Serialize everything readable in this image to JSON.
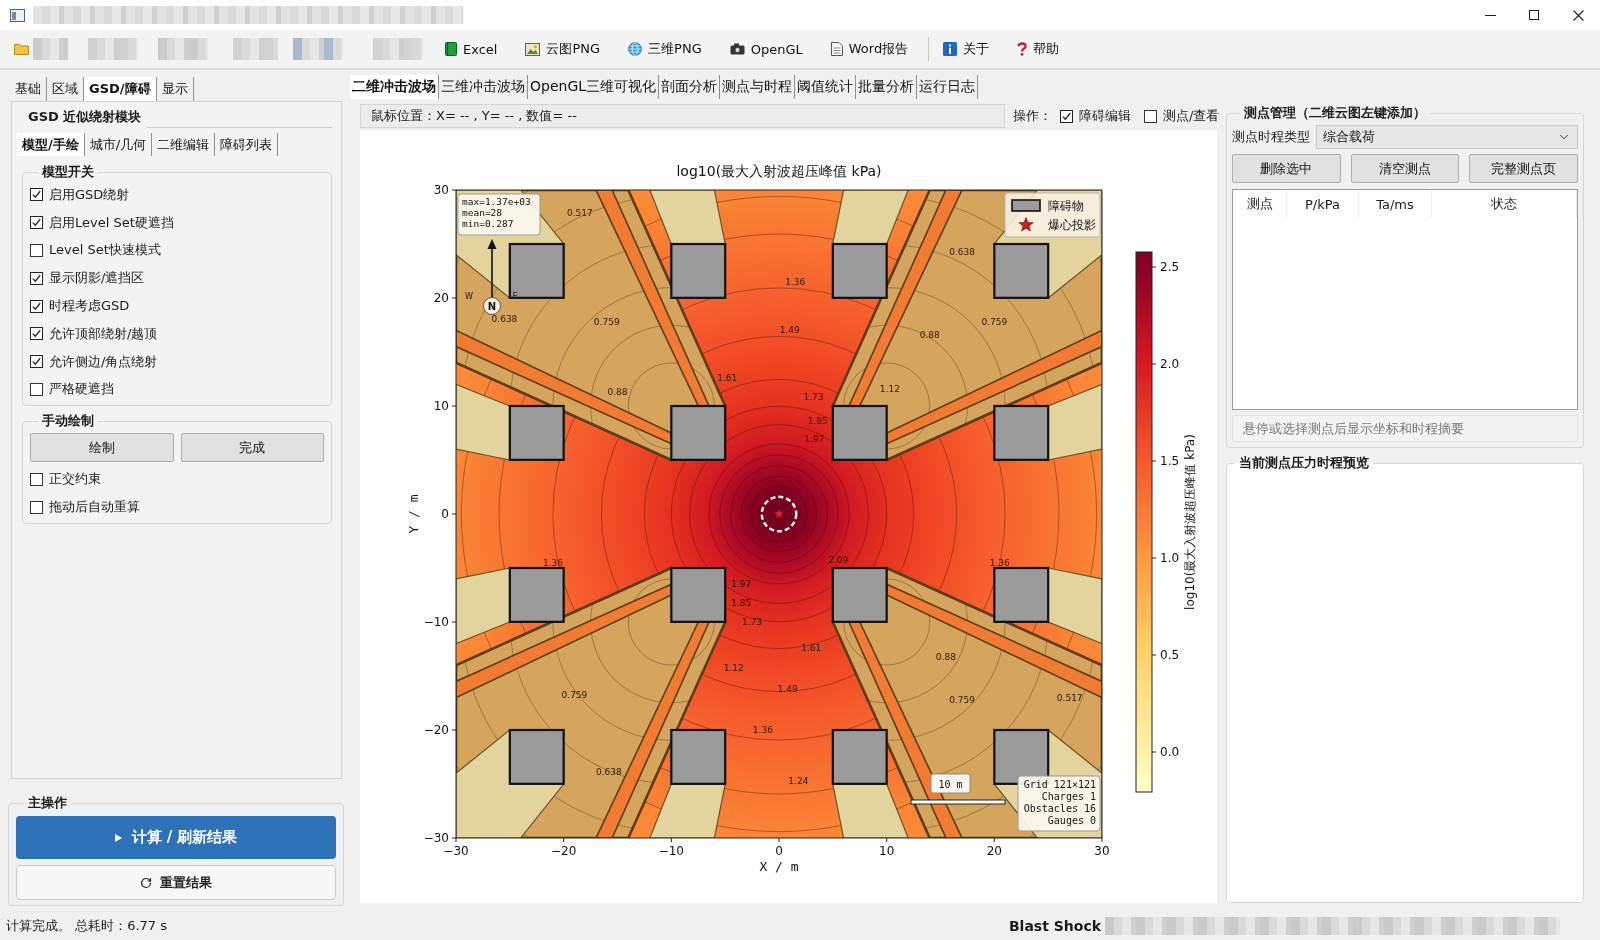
{
  "toolbar": {
    "export_buttons": [
      "Excel",
      "云图PNG",
      "三维PNG",
      "OpenGL",
      "Word报告"
    ],
    "help_buttons": [
      "关于",
      "帮助"
    ]
  },
  "left_panel": {
    "tabs": [
      {
        "label": "基础",
        "selected": false
      },
      {
        "label": "区域",
        "selected": false
      },
      {
        "label": "GSD/障碍",
        "selected": true
      },
      {
        "label": "显示",
        "selected": false
      }
    ],
    "module_title": "GSD 近似绕射模块",
    "sub_tabs": [
      {
        "label": "模型/手绘",
        "selected": true
      },
      {
        "label": "城市/几何",
        "selected": false
      },
      {
        "label": "二维编辑",
        "selected": false
      },
      {
        "label": "障碍列表",
        "selected": false
      }
    ],
    "model_switches": {
      "title": "模型开关",
      "items": [
        {
          "label": "启用GSD绕射",
          "checked": true
        },
        {
          "label": "启用Level Set硬遮挡",
          "checked": true
        },
        {
          "label": "Level Set快速模式",
          "checked": false
        },
        {
          "label": "显示阴影/遮挡区",
          "checked": true
        },
        {
          "label": "时程考虑GSD",
          "checked": true
        },
        {
          "label": "允许顶部绕射/越顶",
          "checked": true
        },
        {
          "label": "允许侧边/角点绕射",
          "checked": true
        },
        {
          "label": "严格硬遮挡",
          "checked": false
        }
      ]
    },
    "manual_draw": {
      "title": "手动绘制",
      "buttons": [
        "绘制",
        "完成"
      ],
      "options": [
        {
          "label": "正交约束",
          "checked": false
        },
        {
          "label": "拖动后自动重算",
          "checked": false
        }
      ]
    },
    "main_actions": {
      "title": "主操作",
      "run_button": "计算 / 刷新结果",
      "reset_button": "重置结果"
    }
  },
  "center_panel": {
    "tabs": [
      {
        "label": "二维冲击波场",
        "selected": true
      },
      {
        "label": "三维冲击波场",
        "selected": false
      },
      {
        "label": "OpenGL三维可视化",
        "selected": false
      },
      {
        "label": "剖面分析",
        "selected": false
      },
      {
        "label": "测点与时程",
        "selected": false
      },
      {
        "label": "阈值统计",
        "selected": false
      },
      {
        "label": "批量分析",
        "selected": false
      },
      {
        "label": "运行日志",
        "selected": false
      }
    ],
    "mouse_position": "鼠标位置：X= -- , Y= -- , 数值= --",
    "operations_label": "操作：",
    "operations": [
      {
        "label": "障碍编辑",
        "checked": true
      },
      {
        "label": "测点/查看",
        "checked": false
      }
    ],
    "plot": {
      "title": "log10(最大入射波超压峰值 kPa)",
      "xlabel": "X / m",
      "ylabel": "Y / m",
      "xticks": [
        "−30",
        "−20",
        "−10",
        "0",
        "10",
        "20",
        "30"
      ],
      "yticks": [
        "30",
        "20",
        "10",
        "0",
        "−10",
        "−20",
        "−30"
      ],
      "colorbar": {
        "label": "log10(最大入射波超压峰值 kPa)",
        "ticks": [
          "2.5",
          "2.0",
          "1.5",
          "1.0",
          "0.5",
          "0.0"
        ]
      },
      "stats": [
        "max=1.37e+03",
        "mean=28",
        "min=0.287"
      ],
      "compass": {
        "west": "W",
        "east": "E",
        "north": "N"
      },
      "legend": [
        {
          "kind": "obstacle",
          "label": "障碍物"
        },
        {
          "kind": "charge",
          "label": "爆心投影"
        }
      ],
      "scale_bar": "10 m",
      "grid_info": [
        "Grid 121×121",
        "Charges 1",
        "Obstacles 16",
        "Gauges 0"
      ],
      "contour_labels": [
        "1.36",
        "1.49",
        "1.61",
        "1.73",
        "1.85",
        "1.97",
        "0.759",
        "0.638",
        "0.88",
        "0.517",
        "0.638",
        "0.759",
        "0.88",
        "1.12",
        "2.09",
        "1.97",
        "1.85",
        "1.73",
        "1.61",
        "1.49",
        "1.36",
        "0.759",
        "0.638",
        "1.12",
        "0.759",
        "0.88",
        "0.517",
        "1.36",
        "1.36",
        "1.24"
      ]
    }
  },
  "right_panel": {
    "gauge_group": {
      "title": "测点管理（二维云图左键添加）",
      "type_label": "测点时程类型",
      "type_value": "综合载荷",
      "buttons": [
        "删除选中",
        "清空测点",
        "完整测点页"
      ],
      "columns": [
        "测点",
        "P/kPa",
        "Ta/ms",
        "状态"
      ],
      "summary": "悬停或选择测点后显示坐标和时程摘要"
    },
    "preview_group": {
      "title": "当前测点压力时程预览"
    }
  },
  "status_bar": {
    "message": "计算完成。 总耗时：6.77 s",
    "app_name": "Blast Shock"
  }
}
